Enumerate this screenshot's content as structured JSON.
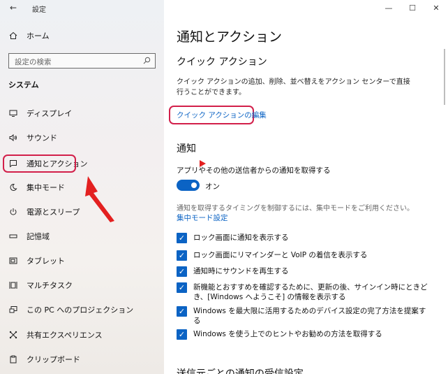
{
  "window": {
    "app_title": "設定",
    "back_glyph": "←",
    "minimize_glyph": "—",
    "maximize_glyph": "☐",
    "close_glyph": "✕"
  },
  "sidebar": {
    "home": {
      "label": "ホーム",
      "icon": "home-icon"
    },
    "search": {
      "placeholder": "設定の検索",
      "icon": "search-icon"
    },
    "section_title": "システム",
    "items": [
      {
        "label": "ディスプレイ",
        "icon": "display-icon",
        "glyph": "▭"
      },
      {
        "label": "サウンド",
        "icon": "speaker-icon",
        "glyph": "🔈"
      },
      {
        "label": "通知とアクション",
        "icon": "notification-icon",
        "glyph": "▢",
        "selected": true
      },
      {
        "label": "集中モード",
        "icon": "moon-icon",
        "glyph": "☽"
      },
      {
        "label": "電源とスリープ",
        "icon": "power-icon",
        "glyph": "⏻"
      },
      {
        "label": "記憶域",
        "icon": "storage-icon",
        "glyph": "▭"
      },
      {
        "label": "タブレット",
        "icon": "tablet-icon",
        "glyph": "▣"
      },
      {
        "label": "マルチタスク",
        "icon": "multitask-icon",
        "glyph": "⊟"
      },
      {
        "label": "この PC へのプロジェクション",
        "icon": "projection-icon",
        "glyph": "⊡"
      },
      {
        "label": "共有エクスペリエンス",
        "icon": "share-icon",
        "glyph": "✕"
      },
      {
        "label": "クリップボード",
        "icon": "clipboard-icon",
        "glyph": "▤"
      }
    ]
  },
  "main": {
    "page_title": "通知とアクション",
    "quick_actions_title": "クイック アクション",
    "quick_actions_desc": "クイック アクションの追加、削除、並べ替えをアクション センターで直接行うことができます。",
    "edit_link": "クイック アクションの編集",
    "notifications_title": "通知",
    "get_notifications_label": "アプリやその他の送信者からの通知を取得する",
    "toggle_state": "オン",
    "focus_hint": "通知を取得するタイミングを制御するには、集中モードをご利用ください。",
    "focus_link": "集中モード設定",
    "checkboxes": [
      {
        "label": "ロック画面に通知を表示する",
        "checked": true
      },
      {
        "label": "ロック画面にリマインダーと VoIP の着信を表示する",
        "checked": true
      },
      {
        "label": "通知時にサウンドを再生する",
        "checked": true
      },
      {
        "label": "新機能とおすすめを確認するために、更新の後、サインイン時にときどき、[Windows へようこそ] の情報を表示する",
        "checked": true
      },
      {
        "label": "Windows を最大限に活用するためのデバイス設定の完了方法を提案する",
        "checked": true
      },
      {
        "label": "Windows を使う上でのヒントやお勧めの方法を取得する",
        "checked": true
      }
    ],
    "cut_off_title": "送信元ごとの通知の受信設定"
  },
  "colors": {
    "accent": "#0b63c4",
    "highlight_ring": "#d21f4a",
    "annotation_arrow": "#e32020"
  }
}
